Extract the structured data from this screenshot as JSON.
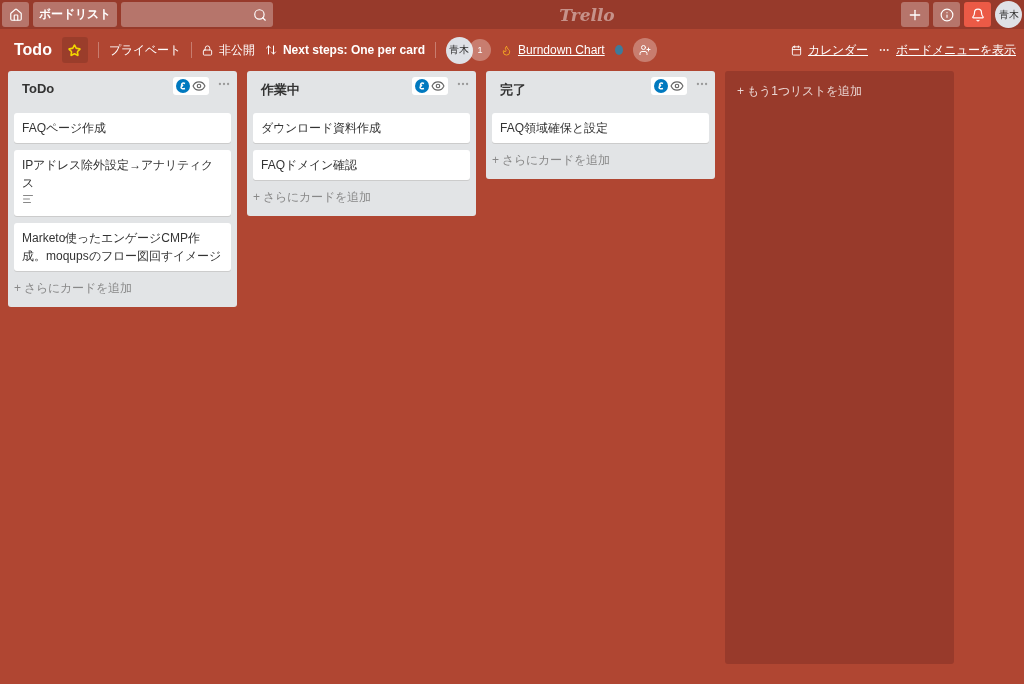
{
  "topbar": {
    "boards_button": "ボードリスト",
    "logo": "Trello",
    "avatar": "青木"
  },
  "board_header": {
    "title": "Todo",
    "starred": true,
    "team": "プライベート",
    "visibility": "非公開",
    "sort": "Next steps: One per card",
    "member": "青木",
    "member_count": "1",
    "burndown": "Burndown Chart",
    "calendar": "カレンダー",
    "menu": "ボードメニューを表示"
  },
  "lists": [
    {
      "title": "ToDo",
      "cards": [
        {
          "text": "FAQページ作成",
          "has_description": false
        },
        {
          "text": "IPアドレス除外設定→アナリティクス",
          "has_description": true
        },
        {
          "text": "Marketo使ったエンゲージCMP作成。moqupsのフロー図回すイメージ",
          "has_description": false
        }
      ],
      "add_card": "+ さらにカードを追加"
    },
    {
      "title": "作業中",
      "cards": [
        {
          "text": "ダウンロード資料作成",
          "has_description": false
        },
        {
          "text": "FAQドメイン確認",
          "has_description": false
        }
      ],
      "add_card": "+ さらにカードを追加"
    },
    {
      "title": "完了",
      "cards": [
        {
          "text": "FAQ領域確保と設定",
          "has_description": false
        }
      ],
      "add_card": "+ さらにカードを追加"
    }
  ],
  "add_list": "+ もう1つリストを追加"
}
